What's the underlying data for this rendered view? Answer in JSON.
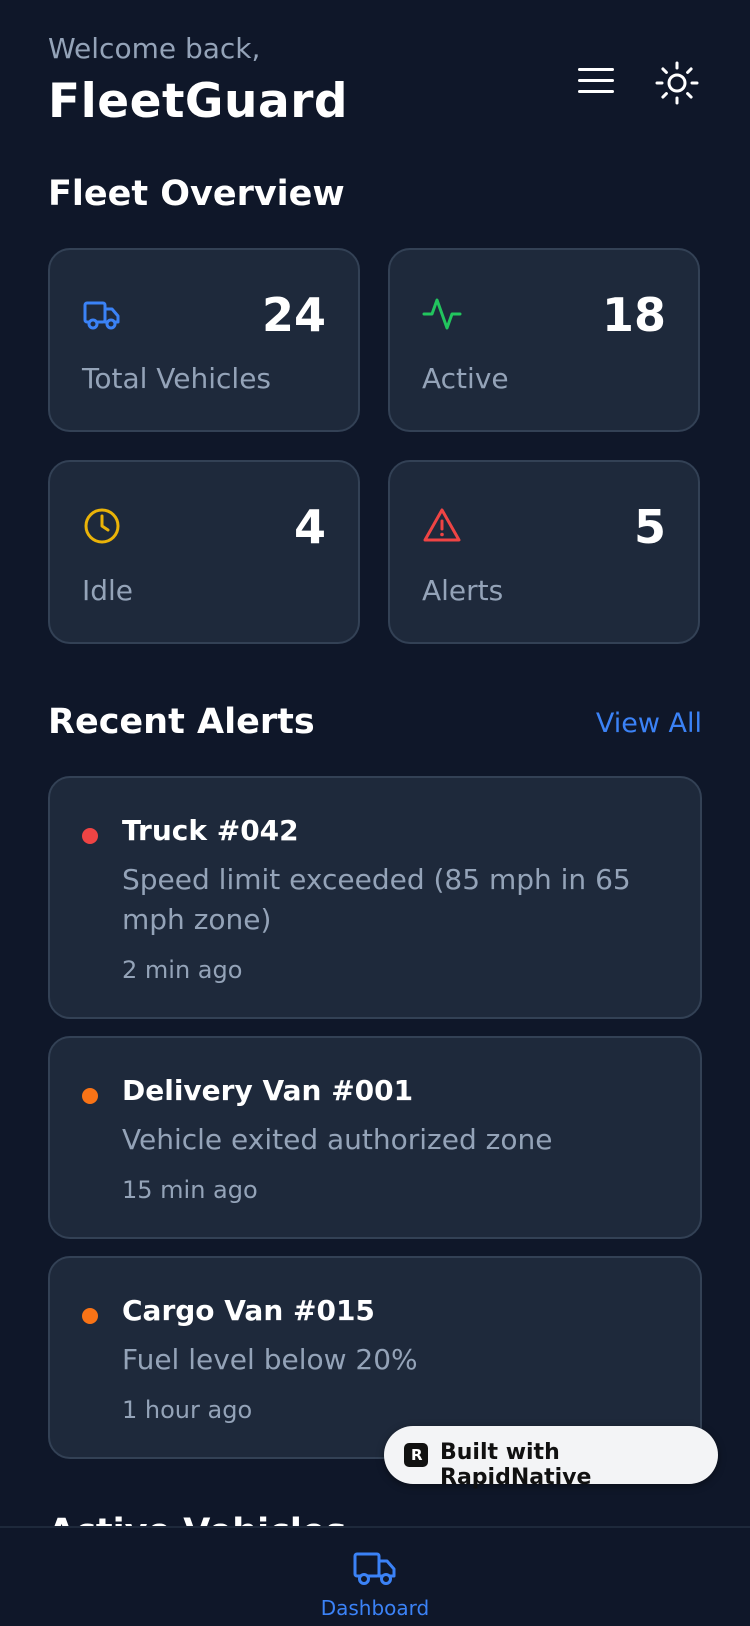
{
  "header": {
    "welcome": "Welcome back,",
    "brand": "FleetGuard",
    "menu_icon": "menu-icon",
    "theme_icon": "sun-icon"
  },
  "overview": {
    "title": "Fleet Overview",
    "stats": [
      {
        "value": "24",
        "label": "Total Vehicles",
        "icon": "truck-icon",
        "color": "#3b82f6"
      },
      {
        "value": "18",
        "label": "Active",
        "icon": "activity-icon",
        "color": "#22c55e"
      },
      {
        "value": "4",
        "label": "Idle",
        "icon": "clock-icon",
        "color": "#eab308"
      },
      {
        "value": "5",
        "label": "Alerts",
        "icon": "alert-triangle-icon",
        "color": "#ef4444"
      }
    ]
  },
  "alerts": {
    "title": "Recent Alerts",
    "view_all": "View All",
    "items": [
      {
        "title": "Truck #042",
        "message": "Speed limit exceeded (85 mph in 65 mph zone)",
        "time": "2 min ago",
        "color": "#ef4444"
      },
      {
        "title": "Delivery Van #001",
        "message": "Vehicle exited authorized zone",
        "time": "15 min ago",
        "color": "#f97316"
      },
      {
        "title": "Cargo Van #015",
        "message": "Fuel level below 20%",
        "time": "1 hour ago",
        "color": "#f97316"
      }
    ]
  },
  "next_section": {
    "title": "Active Vehicles"
  },
  "badge": {
    "text": "Built with RapidNative"
  },
  "nav": {
    "dashboard_label": "Dashboard",
    "dashboard_icon": "truck-icon"
  },
  "colors": {
    "background": "#0f1729",
    "card": "#1e293b",
    "accent": "#3b82f6"
  }
}
